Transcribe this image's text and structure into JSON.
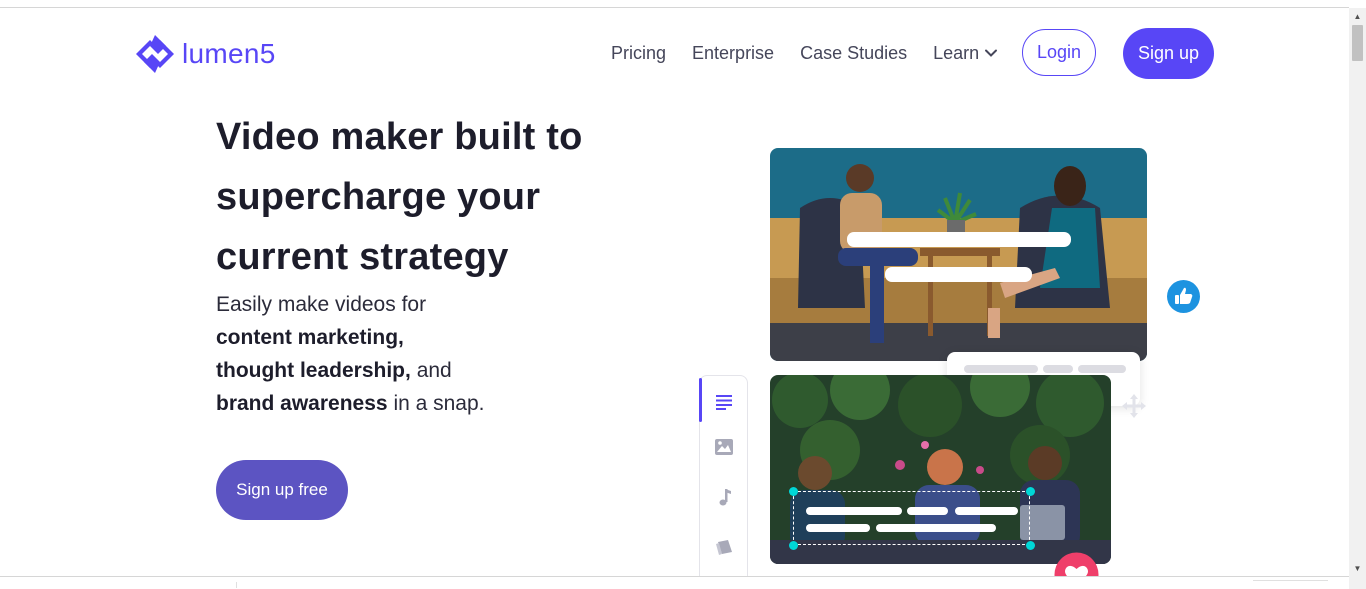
{
  "brand": {
    "name": "lumen5",
    "color": "#5846f6"
  },
  "nav": {
    "links": [
      "Pricing",
      "Enterprise",
      "Case Studies"
    ],
    "learn": "Learn",
    "login": "Login",
    "signup": "Sign up"
  },
  "hero": {
    "title": "Video maker built to supercharge your current strategy",
    "sub_intro": "Easily make videos for",
    "sub_b1": "content marketing,",
    "sub_b2": "thought leadership,",
    "sub_and": "and",
    "sub_b3": "brand awareness",
    "sub_end": "in a snap.",
    "cta": "Sign up free"
  },
  "colors": {
    "accent": "#5846f6",
    "cta": "#5c54c2",
    "like": "#1d93e0",
    "heart": "#ef3f6a",
    "selection": "#00d6d6"
  },
  "icons": [
    "logo-icon",
    "chevron-down-icon",
    "text-icon",
    "image-icon",
    "music-icon",
    "brand-icon",
    "like-icon",
    "move-icon",
    "heart-icon"
  ]
}
